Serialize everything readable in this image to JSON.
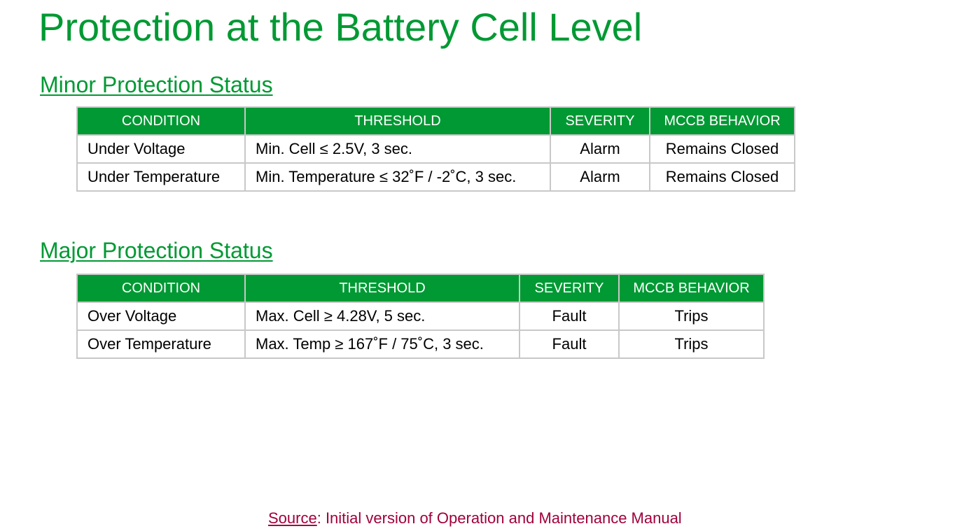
{
  "title": "Protection at the Battery Cell Level",
  "minor": {
    "heading": "Minor Protection Status",
    "headers": [
      "CONDITION",
      "THRESHOLD",
      "SEVERITY",
      "MCCB BEHAVIOR"
    ],
    "rows": [
      [
        "Under Voltage",
        "Min. Cell ≤ 2.5V, 3 sec.",
        "Alarm",
        "Remains Closed"
      ],
      [
        "Under Temperature",
        "Min. Temperature ≤ 32˚F / -2˚C, 3 sec.",
        "Alarm",
        "Remains Closed"
      ]
    ]
  },
  "major": {
    "heading": "Major Protection Status",
    "headers": [
      "CONDITION",
      "THRESHOLD",
      "SEVERITY",
      "MCCB BEHAVIOR"
    ],
    "rows": [
      [
        "Over Voltage",
        "Max. Cell ≥ 4.28V, 5 sec.",
        "Fault",
        "Trips"
      ],
      [
        "Over Temperature",
        "Max. Temp ≥ 167˚F / 75˚C, 3 sec.",
        "Fault",
        "Trips"
      ]
    ]
  },
  "source": {
    "label": "Source",
    "text": ": Initial version of Operation and Maintenance Manual"
  },
  "colors": {
    "accent_green": "#009933",
    "source_red": "#a0003c",
    "grid_gray": "#c8c8c8"
  }
}
